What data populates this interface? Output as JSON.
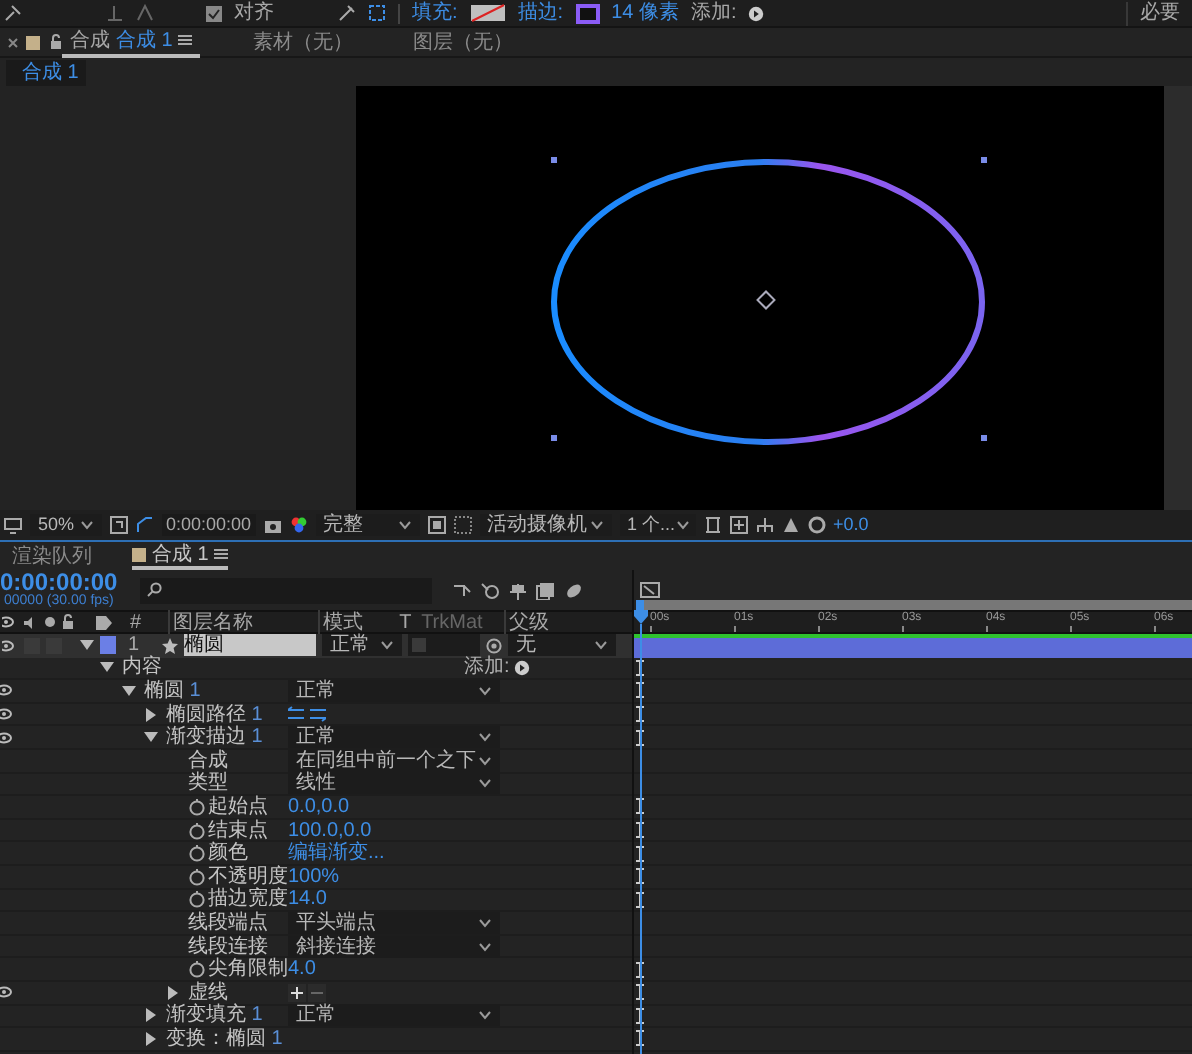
{
  "toolbar": {
    "align": {
      "label": "对齐",
      "checked": true
    },
    "fill_label": "填充:",
    "stroke_label": "描边:",
    "stroke_width": "14 像素",
    "add_label": "添加:",
    "workspace": "必要"
  },
  "panel_tabs": [
    {
      "prefix": "合成",
      "label": "合成 1",
      "selected": true
    },
    {
      "label": "素材（无）",
      "selected": false
    },
    {
      "label": "图层（无）",
      "selected": false
    }
  ],
  "breadcrumb": "合成 1",
  "viewer_toolbar": {
    "zoom": "50%",
    "timecode": "0:00:00:00",
    "resolution": "完整",
    "camera": "活动摄像机",
    "views": "1 个...",
    "exposure": "+0.0"
  },
  "timeline_tabs": [
    {
      "label": "渲染队列",
      "selected": false
    },
    {
      "label": "合成 1",
      "selected": true
    }
  ],
  "timecode": "0:00:00:00",
  "frame_info": "00000 (30.00 fps)",
  "columns": [
    "#",
    "图层名称",
    "模式",
    "T",
    "TrkMat",
    "父级"
  ],
  "ruler": [
    "00s",
    "01s",
    "02s",
    "03s",
    "04s",
    "05s",
    "06s"
  ],
  "layer": {
    "number": "1",
    "name": "椭圆",
    "mode": "正常",
    "parent": "无",
    "color": "#6b7fe6",
    "selected": true
  },
  "properties": [
    {
      "label": "内容",
      "expanded": true,
      "eye": false,
      "marker": true,
      "control": {
        "kind": "add",
        "label": "添加:"
      },
      "children": [
        {
          "label": "椭圆",
          "number": "1",
          "expanded": true,
          "eye": true,
          "marker": true,
          "control": {
            "kind": "dropdown",
            "value": "正常"
          },
          "children": [
            {
              "label": "椭圆路径",
              "number": "1",
              "expanded": false,
              "eye": true,
              "marker": true,
              "control": {
                "kind": "path-direction"
              }
            },
            {
              "label": "渐变描边",
              "number": "1",
              "expanded": true,
              "eye": true,
              "marker": true,
              "control": {
                "kind": "dropdown",
                "value": "正常"
              },
              "children": [
                {
                  "label": "合成",
                  "eye": false,
                  "marker": false,
                  "control": {
                    "kind": "dropdown",
                    "value": "在同组中前一个之下"
                  }
                },
                {
                  "label": "类型",
                  "eye": false,
                  "marker": false,
                  "control": {
                    "kind": "dropdown",
                    "value": "线性"
                  }
                },
                {
                  "label": "起始点",
                  "eye": false,
                  "marker": true,
                  "control": {
                    "kind": "value",
                    "value": "0.0,0.0"
                  }
                },
                {
                  "label": "结束点",
                  "eye": false,
                  "marker": true,
                  "control": {
                    "kind": "value",
                    "value": "100.0,0.0"
                  }
                },
                {
                  "label": "颜色",
                  "eye": false,
                  "marker": true,
                  "control": {
                    "kind": "value",
                    "value": "编辑渐变..."
                  }
                },
                {
                  "label": "不透明度",
                  "eye": false,
                  "marker": true,
                  "control": {
                    "kind": "value",
                    "value": "100%"
                  }
                },
                {
                  "label": "描边宽度",
                  "eye": false,
                  "marker": true,
                  "control": {
                    "kind": "value",
                    "value": "14.0"
                  }
                },
                {
                  "label": "线段端点",
                  "eye": false,
                  "marker": false,
                  "control": {
                    "kind": "dropdown",
                    "value": "平头端点"
                  }
                },
                {
                  "label": "线段连接",
                  "eye": false,
                  "marker": false,
                  "control": {
                    "kind": "dropdown",
                    "value": "斜接连接"
                  }
                },
                {
                  "label": "尖角限制",
                  "eye": false,
                  "marker": true,
                  "control": {
                    "kind": "value",
                    "value": "4.0"
                  }
                },
                {
                  "label": "虚线",
                  "expanded": false,
                  "eye": true,
                  "marker": true,
                  "control": {
                    "kind": "dash-buttons"
                  }
                }
              ]
            },
            {
              "label": "渐变填充",
              "number": "1",
              "expanded": false,
              "eye": false,
              "marker": true,
              "control": {
                "kind": "dropdown",
                "value": "正常"
              }
            },
            {
              "label": "变换：椭圆",
              "number": "1",
              "expanded": false,
              "eye": false,
              "marker": true
            }
          ]
        }
      ]
    }
  ]
}
